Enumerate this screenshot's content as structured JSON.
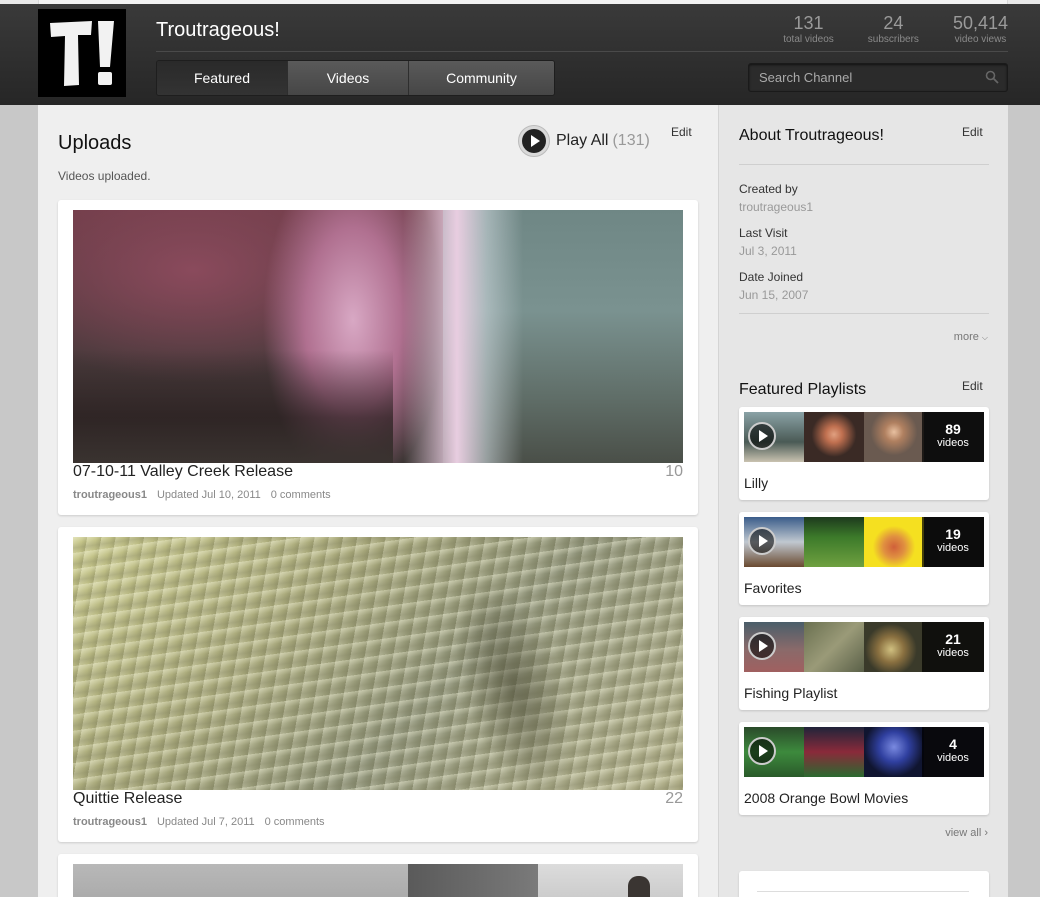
{
  "channel": {
    "title": "Troutrageous!",
    "logo_text": "T!",
    "stats": [
      {
        "value": "131",
        "label": "total videos"
      },
      {
        "value": "24",
        "label": "subscribers"
      },
      {
        "value": "50,414",
        "label": "video views"
      }
    ],
    "tabs": [
      {
        "label": "Featured",
        "active": true
      },
      {
        "label": "Videos",
        "active": false
      },
      {
        "label": "Community",
        "active": false
      }
    ],
    "search_placeholder": "Search Channel",
    "search_icon": "search-icon"
  },
  "uploads": {
    "title": "Uploads",
    "subtitle": "Videos uploaded.",
    "play_all_label": "Play All",
    "play_all_count": "(131)",
    "edit_label": "Edit",
    "videos": [
      {
        "title": "07-10-11 Valley Creek Release",
        "duration": "10",
        "author": "troutrageous1",
        "updated": "Updated Jul 10, 2011",
        "comments": "0 comments"
      },
      {
        "title": "Quittie Release",
        "duration": "22",
        "author": "troutrageous1",
        "updated": "Updated Jul 7, 2011",
        "comments": "0 comments"
      }
    ]
  },
  "about": {
    "title": "About Troutrageous!",
    "edit_label": "Edit",
    "created_by_label": "Created by",
    "created_by_value": "troutrageous1",
    "last_visit_label": "Last Visit",
    "last_visit_value": "Jul 3, 2011",
    "date_joined_label": "Date Joined",
    "date_joined_value": "Jun 15, 2007",
    "more_label": "more"
  },
  "playlists": {
    "title": "Featured Playlists",
    "edit_label": "Edit",
    "view_all_label": "view all ›",
    "items": [
      {
        "name": "Lilly",
        "count": "89",
        "count_label": "videos"
      },
      {
        "name": "Favorites",
        "count": "19",
        "count_label": "videos"
      },
      {
        "name": "Fishing Playlist",
        "count": "21",
        "count_label": "videos"
      },
      {
        "name": "2008 Orange Bowl Movies",
        "count": "4",
        "count_label": "videos"
      }
    ]
  }
}
